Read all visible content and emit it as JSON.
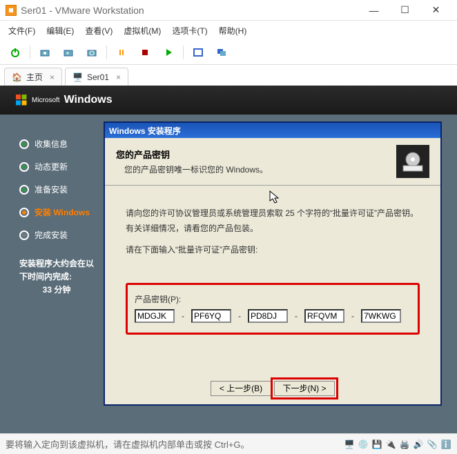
{
  "window": {
    "title": "Ser01 - VMware Workstation",
    "min": "—",
    "max": "☐",
    "close": "✕"
  },
  "menu": {
    "file": "文件(F)",
    "edit": "编辑(E)",
    "view": "查看(V)",
    "vm": "虚拟机(M)",
    "tabs": "选项卡(T)",
    "help": "帮助(H)"
  },
  "tabs": {
    "home": "主页",
    "vm": "Ser01"
  },
  "vm_header": "Windows",
  "steps": {
    "collect": "收集信息",
    "update": "动态更新",
    "prepare": "准备安装",
    "install": "安装  Windows",
    "finish": "完成安装"
  },
  "eta": {
    "l1": "安装程序大约会在以",
    "l2": "下时间内完成:",
    "l3": "33 分钟"
  },
  "dialog": {
    "title": "Windows 安装程序",
    "heading": "您的产品密钥",
    "sub": "您的产品密钥唯一标识您的 Windows。",
    "info1": "请向您的许可协议管理员或系统管理员索取 25 个字符的“批量许可证”产品密钥。有关详细情况，请看您的产品包装。",
    "info2": "请在下面输入“批量许可证”产品密钥:",
    "keylabel": "产品密钥(P):",
    "k1": "MDGJK",
    "k2": "PF6YQ",
    "k3": "PD8DJ",
    "k4": "RFQVM",
    "k5": "7WKWG",
    "back": "< 上一步(B)",
    "next": "下一步(N) >"
  },
  "status": {
    "text": "要将输入定向到该虚拟机，请在虚拟机内部单击或按 Ctrl+G。"
  }
}
